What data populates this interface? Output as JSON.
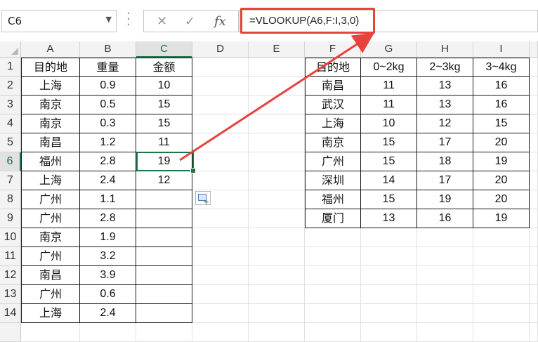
{
  "formula_bar": {
    "name_box": "C6",
    "formula": "=VLOOKUP(A6,F:I,3,0)",
    "cancel_icon": "✕",
    "enter_icon": "✓",
    "fx_label": "fx"
  },
  "columns": [
    "A",
    "B",
    "C",
    "D",
    "E",
    "F",
    "G",
    "H",
    "I"
  ],
  "rows": [
    "1",
    "2",
    "3",
    "4",
    "5",
    "6",
    "7",
    "8",
    "9",
    "10",
    "11",
    "12",
    "13",
    "14",
    ""
  ],
  "left_table": {
    "headers": [
      "目的地",
      "重量",
      "金额"
    ],
    "rows": [
      [
        "上海",
        "0.9",
        "10"
      ],
      [
        "南京",
        "0.5",
        "15"
      ],
      [
        "南京",
        "0.3",
        "15"
      ],
      [
        "南昌",
        "1.2",
        "11"
      ],
      [
        "福州",
        "2.8",
        "19"
      ],
      [
        "上海",
        "2.4",
        "12"
      ],
      [
        "广州",
        "1.1",
        ""
      ],
      [
        "广州",
        "2.8",
        ""
      ],
      [
        "南京",
        "1.9",
        ""
      ],
      [
        "广州",
        "3.2",
        ""
      ],
      [
        "南昌",
        "3.9",
        ""
      ],
      [
        "广州",
        "0.6",
        ""
      ],
      [
        "上海",
        "2.4",
        ""
      ]
    ]
  },
  "right_table": {
    "headers": [
      "目的地",
      "0~2kg",
      "2~3kg",
      "3~4kg"
    ],
    "rows": [
      [
        "南昌",
        "11",
        "13",
        "16"
      ],
      [
        "武汉",
        "11",
        "13",
        "16"
      ],
      [
        "上海",
        "10",
        "12",
        "15"
      ],
      [
        "南京",
        "15",
        "17",
        "20"
      ],
      [
        "广州",
        "15",
        "18",
        "19"
      ],
      [
        "深圳",
        "14",
        "17",
        "20"
      ],
      [
        "福州",
        "15",
        "19",
        "20"
      ],
      [
        "厦门",
        "13",
        "16",
        "19"
      ]
    ]
  },
  "active_cell": "C6",
  "colors": {
    "excel_green": "#217346",
    "annotation_red": "#e8423d"
  }
}
